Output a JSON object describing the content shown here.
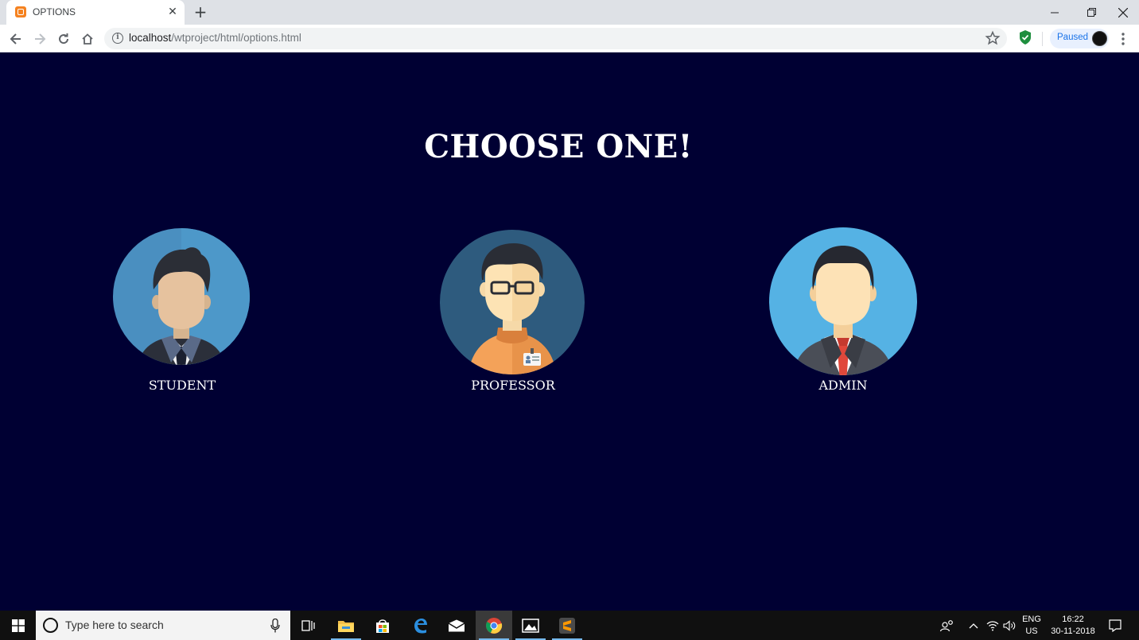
{
  "browser": {
    "tab_title": "OPTIONS",
    "tab_close": "✕",
    "new_tab": "+",
    "url_host": "localhost",
    "url_path": "/wtproject/html/options.html",
    "profile_label": "Paused"
  },
  "page": {
    "heading": "CHOOSE ONE!",
    "options": [
      {
        "label": "STUDENT",
        "icon": "student-avatar-icon"
      },
      {
        "label": "PROFESSOR",
        "icon": "professor-avatar-icon"
      },
      {
        "label": "ADMIN",
        "icon": "admin-avatar-icon"
      }
    ]
  },
  "taskbar": {
    "search_placeholder": "Type here to search",
    "language_top": "ENG",
    "language_bottom": "US",
    "time": "16:22",
    "date": "30-11-2018"
  },
  "colors": {
    "page_background": "#000033",
    "student_circle": "#4a8fc0",
    "professor_circle": "#2e5b7e",
    "admin_circle": "#55b2e4"
  }
}
